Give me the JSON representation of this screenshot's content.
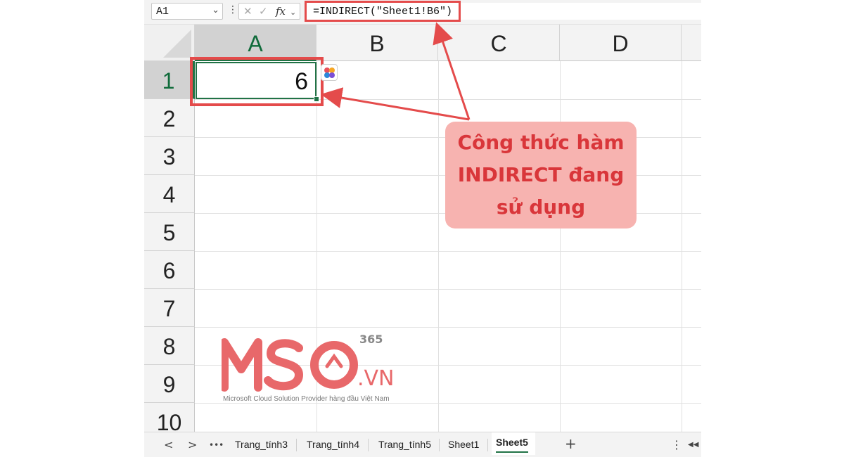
{
  "formula_bar": {
    "name_box": "A1",
    "formula": "=INDIRECT(\"Sheet1!B6\")",
    "fx_label": "fx"
  },
  "columns": [
    "A",
    "B",
    "C",
    "D"
  ],
  "rows": [
    "1",
    "2",
    "3",
    "4",
    "5",
    "6",
    "7",
    "8",
    "9",
    "10"
  ],
  "active_cell": {
    "ref": "A1",
    "value": "6"
  },
  "sheet_tabs": [
    "Trang_tính3",
    "Trang_tính4",
    "Trang_tính5",
    "Sheet1",
    "Sheet5"
  ],
  "active_tab": "Sheet5",
  "nav": {
    "prev": "<",
    "next": ">",
    "more": "•••",
    "add": "+",
    "options": "⋮"
  },
  "callout": {
    "text": "Công thức hàm INDIRECT đang sử dụng"
  },
  "logo": {
    "superscript": "365",
    "suffix": ".VN",
    "tagline": "Microsoft Cloud Solution Provider hàng đầu Việt Nam"
  },
  "colors": {
    "excel_green": "#217346",
    "highlight_red": "#e44b4b",
    "callout_bg": "#f7b3b0",
    "callout_text": "#d9363a",
    "logo_pink": "#e8686a"
  }
}
